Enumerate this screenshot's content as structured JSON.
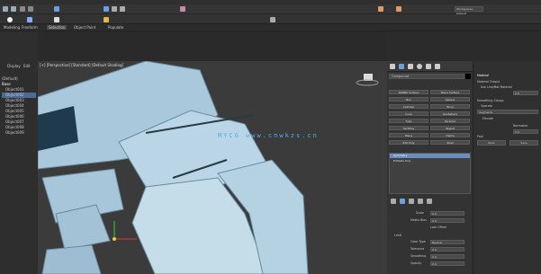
{
  "menu": {
    "items": [
      "File",
      "Edit",
      "Tools",
      "Group",
      "Views",
      "Create",
      "Modifiers",
      "Animation",
      "Graph Editors",
      "Rendering",
      "Civil View",
      "Customize",
      "Scripting",
      "Interactive",
      "Content",
      "Arnold",
      "Help"
    ],
    "workspace": "Workspaces: Default"
  },
  "ribbon": {
    "tabs": [
      "Modeling",
      "Freeform",
      "Selection",
      "Object Paint",
      "Populate"
    ]
  },
  "scene_explorer": {
    "tabs": [
      "Display",
      "Edit"
    ],
    "items": [
      "(Default)",
      "Base",
      "Object001",
      "Object002",
      "Object003",
      "Object004",
      "Object005",
      "Object006",
      "Object007",
      "Object008",
      "Object009"
    ]
  },
  "viewport": {
    "label": "[+] [Perspective] [Standard] [Default Shading]"
  },
  "watermark": "MYCG  www.cnwkzs.cn",
  "command_panel": {
    "object_name": "Compound",
    "buttons": [
      "NURBS Surface",
      "Plane Surface",
      "Box",
      "Sphere",
      "Cylinder",
      "Torus",
      "Cone",
      "GeoSphere",
      "Tube",
      "Pyramid",
      "TextPlus",
      "Teapot",
      "Plane",
      "Hedra",
      "Edit Poly",
      "Shell"
    ],
    "modifier_stack": [
      "Symmetry",
      "Editable Poly"
    ]
  },
  "properties": {
    "title": "Material",
    "rows": [
      "Material Output",
      "Use Line/Mat Material",
      "Smoothing Groups",
      "Operate",
      "Segments",
      "Elevate",
      "Normalize",
      "Pool"
    ],
    "spinners": [
      {
        "label": "Width",
        "value": "0.0"
      },
      {
        "label": "Angle",
        "value": "0.0"
      }
    ],
    "buttons": [
      "Open",
      "Save"
    ]
  },
  "bottom_props": {
    "rows": [
      {
        "label": "Scale",
        "value": "0.0"
      },
      {
        "label": "Matrix Bias",
        "value": "0.0"
      },
      {
        "label": "Lock Offset",
        "value": ""
      }
    ],
    "section": "Limit",
    "extra_rows": [
      {
        "label": "Color Type",
        "value": "Neutral"
      },
      {
        "label": "Tolerance",
        "value": "0.0"
      },
      {
        "label": "Smoothing",
        "value": "0.0"
      },
      {
        "label": "Opacity",
        "value": "0.0"
      }
    ]
  }
}
